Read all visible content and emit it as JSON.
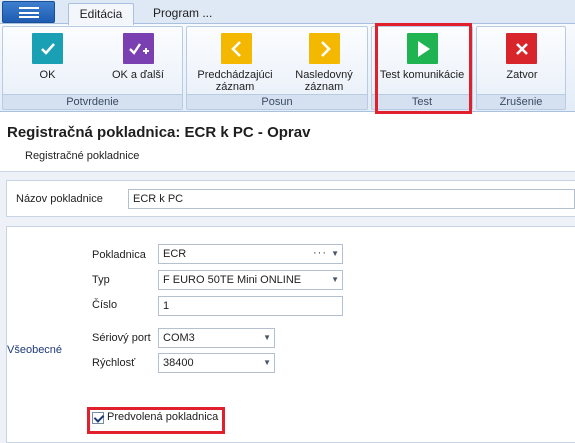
{
  "tabs": {
    "active": "Editácia",
    "other": "Program ..."
  },
  "ribbon": {
    "groups": [
      {
        "label": "Potvrdenie"
      },
      {
        "label": "Posun"
      },
      {
        "label": "Test"
      },
      {
        "label": "Zrušenie"
      }
    ],
    "buttons": {
      "ok": "OK",
      "ok_next": "OK a ďalší",
      "prev_line1": "Predchádzajúci",
      "prev_line2": "záznam",
      "next_line1": "Nasledovný",
      "next_line2": "záznam",
      "test": "Test komunikácie",
      "close": "Zatvor"
    },
    "colors": {
      "ok": "#1aa0b5",
      "ok_next": "#7a3fb0",
      "nav": "#f5b800",
      "test": "#1fb451",
      "close": "#d8252b",
      "highlight": "#e0202a"
    },
    "icons": {
      "ok": "checkmark-icon",
      "ok_next": "checkmark-plus-icon",
      "prev": "chevron-left-icon",
      "next": "chevron-right-icon",
      "test": "play-icon",
      "close": "close-x-icon"
    }
  },
  "header": {
    "title": "Registračná pokladnica: ECR k PC - Oprav",
    "subtitle": "Registračné pokladnice"
  },
  "form": {
    "name_label": "Názov pokladnice",
    "name_value": "ECR k PC",
    "section_label": "Všeobecné",
    "pokladnica_label": "Pokladnica",
    "pokladnica_value": "ECR",
    "typ_label": "Typ",
    "typ_value": "F EURO 50TE Mini ONLINE",
    "cislo_label": "Číslo",
    "cislo_value": "1",
    "port_label": "Sériový port",
    "port_value": "COM3",
    "speed_label": "Rýchlosť",
    "speed_value": "38400",
    "default_label": "Predvolená pokladnica",
    "default_checked": true
  }
}
